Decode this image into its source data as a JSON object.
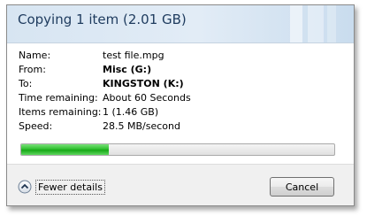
{
  "dialog": {
    "title": "Copying 1 item (2.01 GB)"
  },
  "details": {
    "name_label": "Name:",
    "name_value": "test file.mpg",
    "from_label": "From:",
    "from_value": "Misc (G:)",
    "to_label": "To:",
    "to_value": "KINGSTON (K:)",
    "time_label": "Time remaining:",
    "time_value": "About 60 Seconds",
    "items_label": "Items remaining:",
    "items_value": "1 (1.46 GB)",
    "speed_label": "Speed:",
    "speed_value": "28.5 MB/second"
  },
  "progress": {
    "percent": 28,
    "color": "#2fbf2f"
  },
  "footer": {
    "fewer_details_label": "Fewer details",
    "fewer_details_icon": "chevron-up-icon",
    "cancel_label": "Cancel"
  },
  "colors": {
    "title_text": "#1e3b5e",
    "header_bg": "#dfe9f4",
    "footer_bg": "#f0f0f0"
  }
}
